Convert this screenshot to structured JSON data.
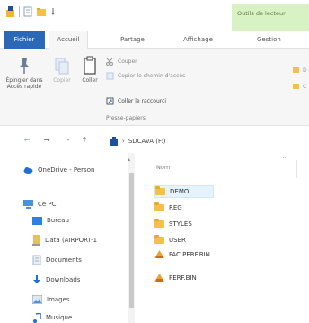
{
  "quick_access": {
    "icons": [
      "app-icon",
      "properties-icon",
      "new-folder-icon",
      "dropdown-icon"
    ]
  },
  "context_tab": {
    "label": "Outils de lecteur"
  },
  "tabs": [
    {
      "label": "Fichier"
    },
    {
      "label": "Accueil"
    },
    {
      "label": "Partage"
    },
    {
      "label": "Affichage"
    },
    {
      "label": "Gestion"
    }
  ],
  "ribbon": {
    "pin": {
      "label_line1": "Épingler dans",
      "label_line2": "Accès rapide"
    },
    "copy": {
      "label": "Copier"
    },
    "paste": {
      "label": "Coller"
    },
    "cut": {
      "label": "Couper"
    },
    "copy_path": {
      "label": "Copier le chemin d'accès"
    },
    "paste_shortcut": {
      "label": "Coller le raccourci"
    },
    "group_label": "Presse-papiers",
    "right_cmds": [
      "D",
      "C"
    ]
  },
  "address": {
    "back": "←",
    "forward": "→",
    "up": "↑",
    "path": "SDCAVA (F:)"
  },
  "nav_pane": {
    "items": [
      {
        "label": "OneDrive - Person",
        "icon": "cloud-icon"
      },
      {
        "label": "Ce PC",
        "icon": "computer-icon"
      },
      {
        "label": "Bureau",
        "icon": "desktop-icon"
      },
      {
        "label": "Data (AIRPORT-1",
        "icon": "network-drive-icon"
      },
      {
        "label": "Documents",
        "icon": "documents-icon"
      },
      {
        "label": "Downloads",
        "icon": "downloads-icon"
      },
      {
        "label": "Images",
        "icon": "images-icon"
      },
      {
        "label": "Musique",
        "icon": "music-icon"
      }
    ]
  },
  "content": {
    "column_header": "Nom",
    "files": [
      {
        "name": "DEMO",
        "type": "folder"
      },
      {
        "name": "REG",
        "type": "folder"
      },
      {
        "name": "STYLES",
        "type": "folder"
      },
      {
        "name": "USER",
        "type": "folder"
      },
      {
        "name": "FAC PERF.BIN",
        "type": "shortcut"
      },
      {
        "name": "PERF.BIN",
        "type": "shortcut"
      }
    ]
  },
  "colors": {
    "file_tab": "#2b68b8",
    "context_tab": "#d9f2c4",
    "folder": "#f5c04a",
    "selection": "#e5f3ff"
  }
}
